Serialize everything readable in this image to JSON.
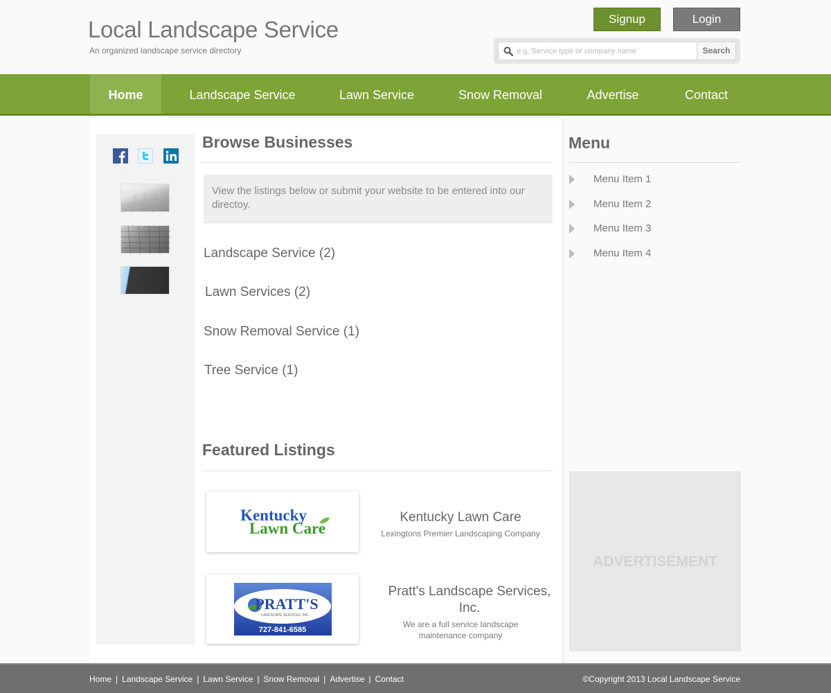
{
  "header": {
    "title": "Local Landscape Service",
    "tagline": "An organized landscape service directory",
    "signup_label": "Signup",
    "login_label": "Login",
    "search_placeholder": "e.g. Service type or company name",
    "search_button": "Search"
  },
  "nav": {
    "items": [
      {
        "label": "Home",
        "active": true
      },
      {
        "label": "Landscape Service"
      },
      {
        "label": "Lawn Service"
      },
      {
        "label": "Snow Removal"
      },
      {
        "label": "Advertise"
      },
      {
        "label": "Contact"
      }
    ]
  },
  "social": [
    "facebook-icon",
    "twitter-icon",
    "linkedin-icon"
  ],
  "browse": {
    "title": "Browse Businesses",
    "intro": "View the listings below or submit your website to be entered into our directoy.",
    "categories": [
      "Landscape Service (2)",
      "Lawn Services (2)",
      "Snow Removal Service (1)",
      "Tree Service (1)"
    ]
  },
  "featured": {
    "title": "Featured Listings",
    "listings": [
      {
        "name": "Kentucky Lawn Care",
        "description": "Lexingtons Premier Landscaping Company",
        "logo_line1": "Kentucky",
        "logo_line2": "Lawn Care"
      },
      {
        "name": "Pratt's Landscape Services, Inc.",
        "description": "We are a full service landscape maintenance company",
        "logo_name": "PRATT'S",
        "logo_sub": "LANDSCAPE SERVICES, INC.",
        "logo_phone": "727-841-6585"
      }
    ]
  },
  "sidebar": {
    "title": "Menu",
    "items": [
      "Menu Item 1",
      "Menu Item 2",
      "Menu Item 3",
      "Menu Item 4"
    ],
    "ad_label": "ADVERTISEMENT"
  },
  "footer": {
    "links": [
      "Home",
      "Landscape Service",
      "Lawn Service",
      "Snow Removal",
      "Advertise",
      "Contact"
    ],
    "separator": "|",
    "copyright": "©Copyright 2013 Local Landscape Service"
  },
  "colors": {
    "brand_green": "#7ea336",
    "nav_active": "#8fb24f",
    "signup_green": "#6e9130",
    "login_gray": "#7a7a7a",
    "footer_gray": "#6f6f6f"
  }
}
